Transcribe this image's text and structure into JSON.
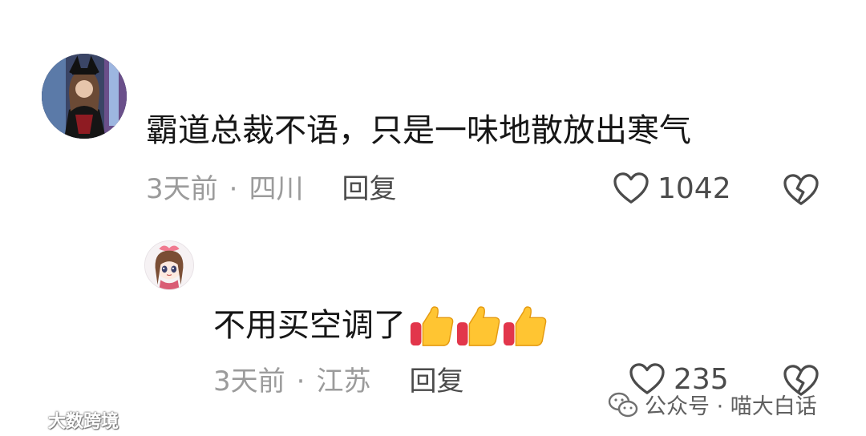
{
  "comments": [
    {
      "text": "霸道总裁不语，只是一味地散放出寒气",
      "time": "3天前",
      "separator": "·",
      "location": "四川",
      "reply_label": "回复",
      "likes": "1042",
      "avatar_icon": "user-avatar-girl-dark-outfit"
    },
    {
      "text": "不用买空调了",
      "emoji": [
        "thumbs-up",
        "thumbs-up",
        "thumbs-up"
      ],
      "time": "3天前",
      "separator": "·",
      "location": "江苏",
      "reply_label": "回复",
      "likes": "235",
      "avatar_icon": "anime-girl-avatar"
    }
  ],
  "icons": {
    "like": "heart-outline-icon",
    "dislike": "broken-heart-icon"
  },
  "watermarks": {
    "left": "大数跨境",
    "right": "公众号 · 喵大白话"
  },
  "colors": {
    "text": "#161616",
    "meta": "#9b9b9b",
    "action": "#4b4b4b"
  }
}
